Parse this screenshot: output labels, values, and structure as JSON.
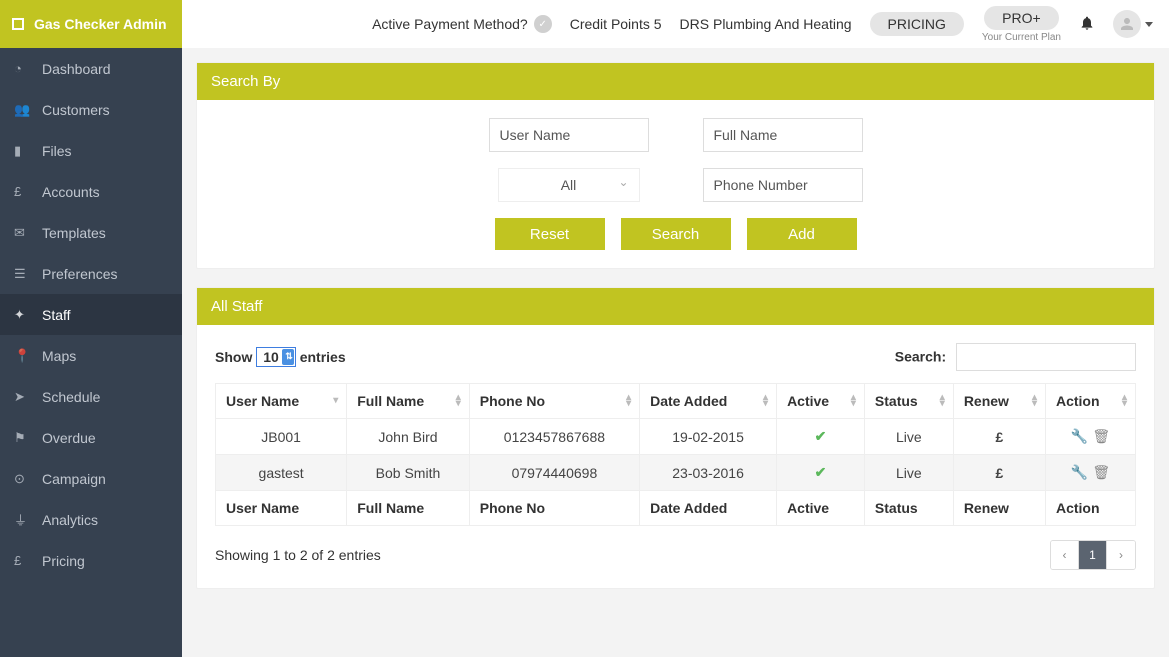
{
  "brand": "Gas Checker Admin",
  "sidebar": {
    "items": [
      {
        "label": "Dashboard",
        "icon": "◔"
      },
      {
        "label": "Customers",
        "icon": "👥"
      },
      {
        "label": "Files",
        "icon": "▮"
      },
      {
        "label": "Accounts",
        "icon": "£"
      },
      {
        "label": "Templates",
        "icon": "✉"
      },
      {
        "label": "Preferences",
        "icon": "☰"
      },
      {
        "label": "Staff",
        "icon": "✦"
      },
      {
        "label": "Maps",
        "icon": "📍"
      },
      {
        "label": "Schedule",
        "icon": "➤"
      },
      {
        "label": "Overdue",
        "icon": "⚑"
      },
      {
        "label": "Campaign",
        "icon": "⊙"
      },
      {
        "label": "Analytics",
        "icon": "⏚"
      },
      {
        "label": "Pricing",
        "icon": "£"
      }
    ],
    "active_index": 6
  },
  "topbar": {
    "payment_q": "Active Payment Method?",
    "credit_points_label": "Credit Points 5",
    "company": "DRS Plumbing And Heating",
    "pricing_btn": "PRICING",
    "plan_btn": "PRO+",
    "plan_note": "Your Current Plan"
  },
  "search_panel": {
    "title": "Search By",
    "username_ph": "User Name",
    "fullname_ph": "Full Name",
    "role_selected": "All",
    "phone_ph": "Phone Number",
    "reset": "Reset",
    "search": "Search",
    "add": "Add"
  },
  "staff_panel": {
    "title": "All Staff",
    "show_label_pre": "Show",
    "show_value": "10",
    "show_label_post": "entries",
    "search_label": "Search:",
    "columns": [
      "User Name",
      "Full Name",
      "Phone No",
      "Date Added",
      "Active",
      "Status",
      "Renew",
      "Action"
    ],
    "rows": [
      {
        "user": "JB001",
        "full": "John Bird",
        "phone": "0123457867688",
        "date": "19-02-2015",
        "active": true,
        "status": "Live",
        "renew": "£"
      },
      {
        "user": "gastest",
        "full": "Bob Smith",
        "phone": "07974440698",
        "date": "23-03-2016",
        "active": true,
        "status": "Live",
        "renew": "£"
      }
    ],
    "info": "Showing 1 to 2 of 2 entries",
    "page_current": "1"
  }
}
